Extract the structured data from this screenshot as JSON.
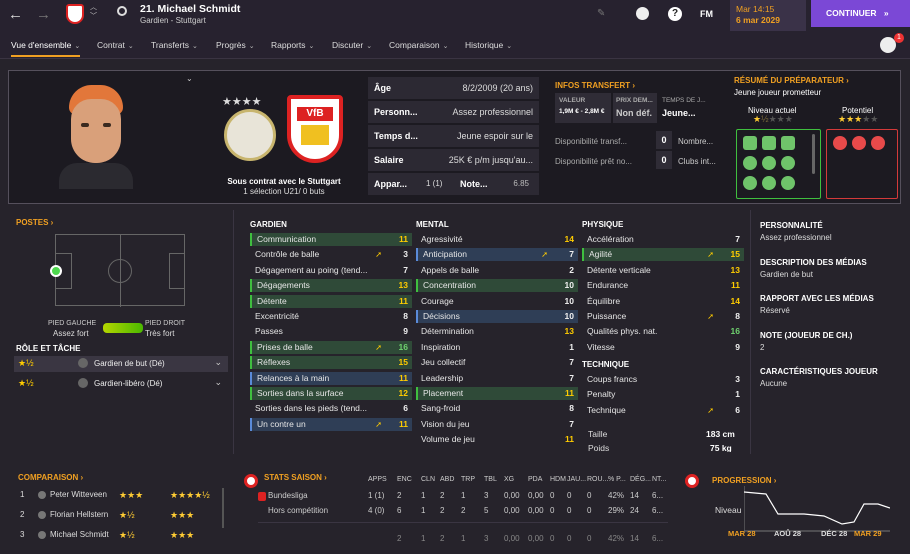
{
  "topbar": {
    "player_title": "21. Michael Schmidt",
    "subtitle": "Gardien - Stuttgart",
    "fm": "FM",
    "time": "Mar 14:15",
    "date": "6 mar 2029",
    "continue": "CONTINUER"
  },
  "nav": [
    "Vue d'ensemble",
    "Contrat",
    "Transferts",
    "Progrès",
    "Rapports",
    "Discuter",
    "Comparaison",
    "Historique"
  ],
  "badge_count": "1",
  "profile": {
    "contract_text": "Sous contrat avec le Stuttgart",
    "caps": "1 sélection U21/ 0 buts",
    "rows": [
      {
        "k": "Âge",
        "v": "8/2/2009 (20 ans)"
      },
      {
        "k": "Personn...",
        "v": "Assez professionnel"
      },
      {
        "k": "Temps d...",
        "v": "Jeune espoir sur le"
      },
      {
        "k": "Salaire",
        "v": "25K € p/m jusqu'au..."
      }
    ],
    "app_label": "Appar...",
    "app_value": "1 (1)",
    "note_label": "Note...",
    "note_value": "6.85"
  },
  "transfer": {
    "title": "INFOS TRANSFERT ›",
    "valeur_lbl": "VALEUR",
    "valeur": "1,9M € - 2,8M €",
    "prix_lbl": "PRIX DEM...",
    "prix": "Non déf.",
    "temps_lbl": "TEMPS DE J...",
    "temps": "Jeune...",
    "dispo1": "Disponibilité transf...",
    "dispo1_v": "0",
    "dispo2": "Disponibilité prêt no...",
    "dispo2_v": "0",
    "nombre": "Nombre...",
    "clubs": "Clubs int..."
  },
  "coach": {
    "title": "RÉSUMÉ DU PRÉPARATEUR ›",
    "summary": "Jeune joueur prometteur",
    "current_lbl": "Niveau actuel",
    "potential_lbl": "Potentiel",
    "current_stars": 1.5,
    "potential_stars": 3
  },
  "positions": {
    "title": "POSTES ›",
    "left_foot_lbl": "PIED GAUCHE",
    "left_foot": "Assez fort",
    "right_foot_lbl": "PIED DROIT",
    "right_foot": "Très fort"
  },
  "roles": {
    "title": "RÔLE ET TÂCHE",
    "items": [
      {
        "stars": "★½",
        "name": "Gardien de but (Dé)"
      },
      {
        "stars": "★½",
        "name": "Gardien-libéro (Dé)"
      }
    ]
  },
  "gk": {
    "title": "GARDIEN",
    "items": [
      {
        "n": "Communication",
        "v": "11",
        "c": "hl",
        "col": "y"
      },
      {
        "n": "Contrôle de balle",
        "v": "3",
        "c": "",
        "col": "w",
        "arrow": true
      },
      {
        "n": "Dégagement au poing (tend...",
        "v": "7",
        "c": "",
        "col": "w"
      },
      {
        "n": "Dégagements",
        "v": "13",
        "c": "hl",
        "col": "y"
      },
      {
        "n": "Détente",
        "v": "11",
        "c": "hl",
        "col": "y"
      },
      {
        "n": "Excentricité",
        "v": "8",
        "c": "",
        "col": "w"
      },
      {
        "n": "Passes",
        "v": "9",
        "c": "",
        "col": "w"
      },
      {
        "n": "Prises de balle",
        "v": "16",
        "c": "hl",
        "col": "g",
        "arrow": true
      },
      {
        "n": "Réflexes",
        "v": "15",
        "c": "hl",
        "col": "y"
      },
      {
        "n": "Relances à la main",
        "v": "11",
        "c": "hlb",
        "col": "y"
      },
      {
        "n": "Sorties dans la surface",
        "v": "12",
        "c": "hl",
        "col": "y"
      },
      {
        "n": "Sorties dans les pieds (tend...",
        "v": "6",
        "c": "",
        "col": "w"
      },
      {
        "n": "Un contre un",
        "v": "11",
        "c": "hlb",
        "col": "y",
        "arrow": true
      }
    ]
  },
  "mental": {
    "title": "MENTAL",
    "items": [
      {
        "n": "Agressivité",
        "v": "14",
        "c": "",
        "col": "y"
      },
      {
        "n": "Anticipation",
        "v": "7",
        "c": "hlb",
        "col": "w",
        "arrow": true
      },
      {
        "n": "Appels de balle",
        "v": "2",
        "c": "",
        "col": "w"
      },
      {
        "n": "Concentration",
        "v": "10",
        "c": "hl",
        "col": "w"
      },
      {
        "n": "Courage",
        "v": "10",
        "c": "",
        "col": "w"
      },
      {
        "n": "Décisions",
        "v": "10",
        "c": "hlb",
        "col": "w"
      },
      {
        "n": "Détermination",
        "v": "13",
        "c": "",
        "col": "y"
      },
      {
        "n": "Inspiration",
        "v": "1",
        "c": "",
        "col": "w"
      },
      {
        "n": "Jeu collectif",
        "v": "7",
        "c": "",
        "col": "w"
      },
      {
        "n": "Leadership",
        "v": "7",
        "c": "",
        "col": "w"
      },
      {
        "n": "Placement",
        "v": "11",
        "c": "hl",
        "col": "y"
      },
      {
        "n": "Sang-froid",
        "v": "8",
        "c": "",
        "col": "w"
      },
      {
        "n": "Vision du jeu",
        "v": "7",
        "c": "",
        "col": "w"
      },
      {
        "n": "Volume de jeu",
        "v": "11",
        "c": "",
        "col": "y"
      }
    ]
  },
  "physical": {
    "title": "PHYSIQUE",
    "items": [
      {
        "n": "Accélération",
        "v": "7",
        "c": "",
        "col": "w"
      },
      {
        "n": "Agilité",
        "v": "15",
        "c": "hl",
        "col": "y",
        "arrow": true
      },
      {
        "n": "Détente verticale",
        "v": "13",
        "c": "",
        "col": "y"
      },
      {
        "n": "Endurance",
        "v": "11",
        "c": "",
        "col": "y"
      },
      {
        "n": "Équilibre",
        "v": "14",
        "c": "",
        "col": "y"
      },
      {
        "n": "Puissance",
        "v": "8",
        "c": "",
        "col": "w",
        "arrow": true
      },
      {
        "n": "Qualités phys. nat.",
        "v": "16",
        "c": "",
        "col": "g"
      },
      {
        "n": "Vitesse",
        "v": "9",
        "c": "",
        "col": "w"
      }
    ]
  },
  "technique": {
    "title": "TECHNIQUE",
    "items": [
      {
        "n": "Coups francs",
        "v": "3",
        "c": "",
        "col": "w"
      },
      {
        "n": "Penalty",
        "v": "1",
        "c": "",
        "col": "w"
      },
      {
        "n": "Technique",
        "v": "6",
        "c": "",
        "col": "w",
        "arrow": true
      }
    ]
  },
  "body": {
    "taille_lbl": "Taille",
    "taille": "183 cm",
    "poids_lbl": "Poids",
    "poids": "75 kg"
  },
  "info": [
    {
      "t": "PERSONNALITÉ",
      "v": "Assez professionnel"
    },
    {
      "t": "DESCRIPTION DES MÉDIAS",
      "v": "Gardien de but"
    },
    {
      "t": "RAPPORT AVEC LES MÉDIAS",
      "v": "Réservé"
    },
    {
      "t": "NOTE (JOUEUR DE CH.)",
      "v": "2"
    },
    {
      "t": "CARACTÉRISTIQUES JOUEUR",
      "v": "Aucune"
    }
  ],
  "comparison": {
    "title": "COMPARAISON ›",
    "rows": [
      {
        "rank": "1",
        "name": "Peter Witteveen",
        "s1": "★★★",
        "s2": "★★★★½"
      },
      {
        "rank": "2",
        "name": "Florian Hellstern",
        "s1": "★½",
        "s2": "★★★"
      },
      {
        "rank": "3",
        "name": "Michael Schmidt",
        "s1": "★½",
        "s2": "★★★"
      }
    ]
  },
  "stats": {
    "title": "STATS SAISON ›",
    "headers": [
      "APPS",
      "ENC",
      "CLN",
      "ABD",
      "TRP",
      "TBL",
      "XG",
      "PDA",
      "HDM",
      "JAU...",
      "ROU...",
      "% P...",
      "DÉG...",
      "NT..."
    ],
    "rows": [
      {
        "comp": "Bundesliga",
        "vals": [
          "1 (1)",
          "2",
          "1",
          "2",
          "1",
          "3",
          "0,00",
          "0,00",
          "0",
          "0",
          "0",
          "42%",
          "14",
          "6..."
        ]
      },
      {
        "comp": "Hors compétition",
        "vals": [
          "4 (0)",
          "6",
          "1",
          "2",
          "2",
          "5",
          "0,00",
          "0,00",
          "0",
          "0",
          "0",
          "29%",
          "24",
          "6..."
        ]
      },
      {
        "comp": "",
        "vals": [
          "",
          "2",
          "1",
          "2",
          "1",
          "3",
          "0,00",
          "0,00",
          "0",
          "0",
          "0",
          "42%",
          "14",
          "6..."
        ]
      }
    ]
  },
  "progress": {
    "title": "PROGRESSION ›",
    "ylabel": "Niveau",
    "labels": [
      "MAR 28",
      "AOÛ 28",
      "DÉC 28",
      "MAR 29"
    ]
  }
}
